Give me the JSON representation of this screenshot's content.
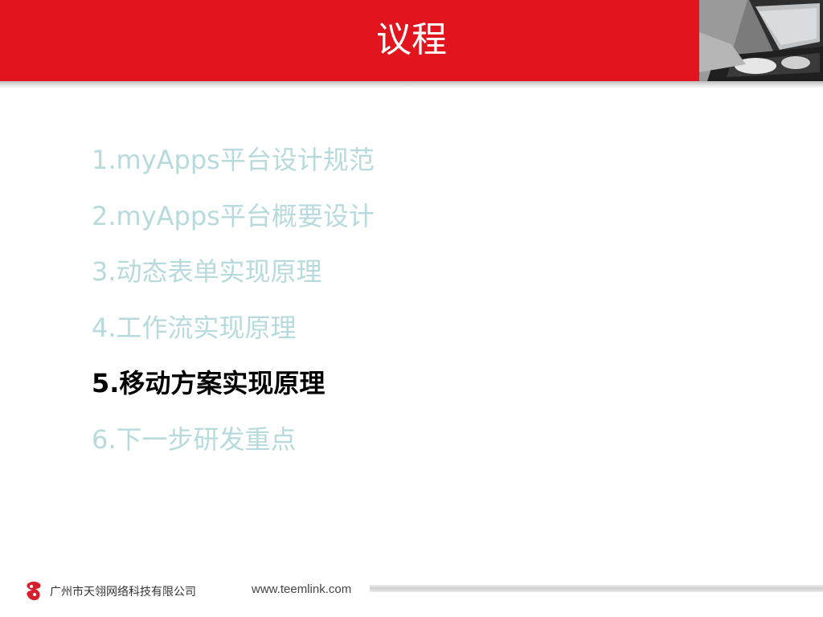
{
  "slide": {
    "title": "议程",
    "accent_color": "#e2151f",
    "inactive_item_color": "#b7dadd",
    "active_item_color": "#000000"
  },
  "agenda": {
    "items": [
      {
        "label": "1.myApps平台设计规范",
        "active": false
      },
      {
        "label": "2.myApps平台概要设计",
        "active": false
      },
      {
        "label": "3.动态表单实现原理",
        "active": false
      },
      {
        "label": "4.工作流实现原理",
        "active": false
      },
      {
        "label": "5.移动方案实现原理",
        "active": true
      },
      {
        "label": "6.下一步研发重点",
        "active": false
      }
    ]
  },
  "footer": {
    "company": "广州市天翎网络科技有限公司",
    "website": "www.teemlink.com",
    "logo_icon": "teemlink-logo-icon"
  },
  "header": {
    "photo": "laptop-typing-photo"
  }
}
